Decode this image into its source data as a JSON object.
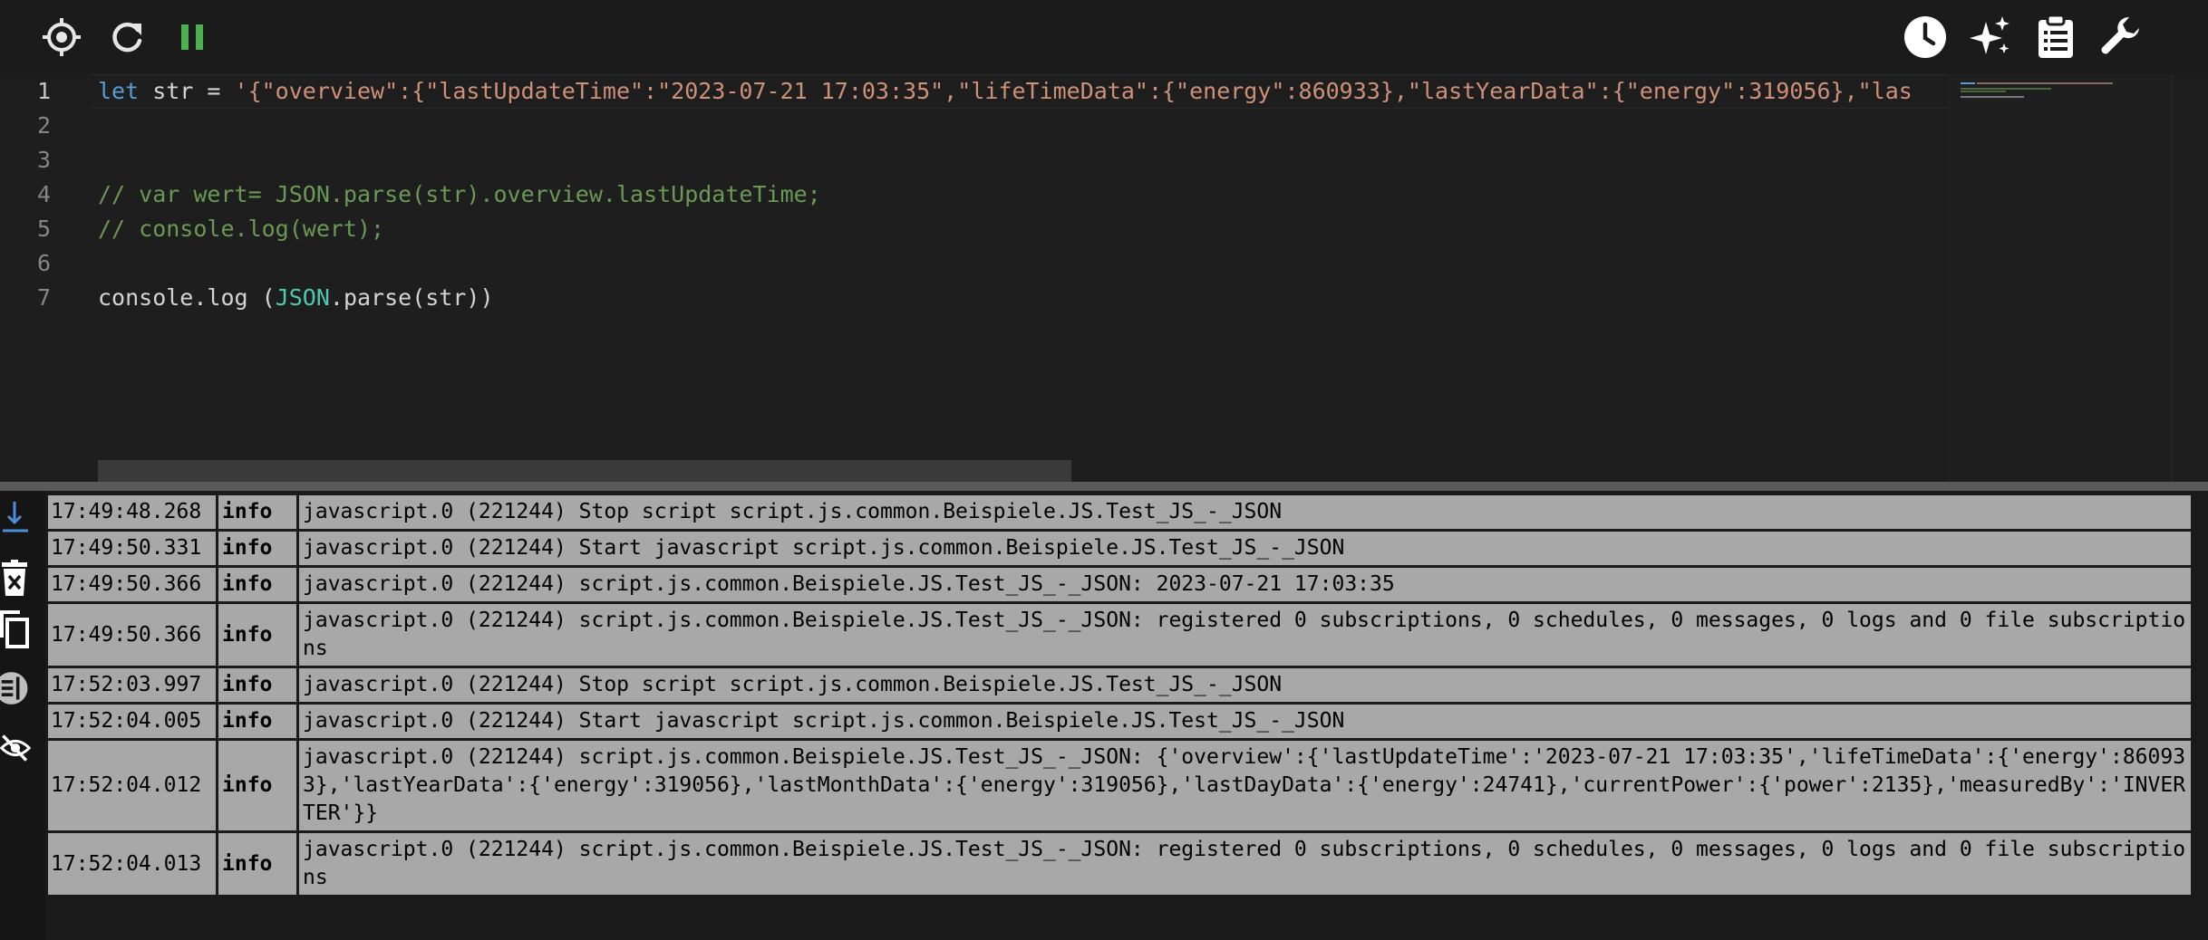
{
  "toolbar": {
    "left_icons": [
      "target-icon",
      "refresh-icon",
      "pause-icon"
    ],
    "right_icons": [
      "clock-icon",
      "sparkles-icon",
      "clipboard-list-icon",
      "wrench-icon"
    ],
    "pause_color": "#4caf50"
  },
  "editor": {
    "active_line": 1,
    "line_numbers": [
      "1",
      "2",
      "3",
      "4",
      "5",
      "6",
      "7"
    ],
    "lines": {
      "l1_kw": "let",
      "l1_mid": " str = ",
      "l1_str": "'{\"overview\":{\"lastUpdateTime\":\"2023-07-21 17:03:35\",\"lifeTimeData\":{\"energy\":860933},\"lastYearData\":{\"energy\":319056},\"las",
      "l4": "// var wert= JSON.parse(str).overview.lastUpdateTime;",
      "l5": "// console.log(wert);",
      "l7_a": "console.log (",
      "l7_type": "JSON",
      "l7_b": ".parse(str))"
    },
    "colors": {
      "keyword": "#569cd6",
      "string": "#ce9178",
      "comment": "#6a9955",
      "type": "#4ec9b0"
    }
  },
  "log_tools": [
    "scroll-to-bottom-icon",
    "delete-log-icon",
    "copy-icon",
    "columns-icon",
    "hide-icon"
  ],
  "log": {
    "rows": [
      {
        "time": "17:49:48.268",
        "severity": "info",
        "message": "javascript.0 (221244) Stop script script.js.common.Beispiele.JS.Test_JS_-_JSON"
      },
      {
        "time": "17:49:50.331",
        "severity": "info",
        "message": "javascript.0 (221244) Start javascript script.js.common.Beispiele.JS.Test_JS_-_JSON"
      },
      {
        "time": "17:49:50.366",
        "severity": "info",
        "message": "javascript.0 (221244) script.js.common.Beispiele.JS.Test_JS_-_JSON: 2023-07-21 17:03:35"
      },
      {
        "time": "17:49:50.366",
        "severity": "info",
        "message": "javascript.0 (221244) script.js.common.Beispiele.JS.Test_JS_-_JSON: registered 0 subscriptions, 0 schedules, 0 messages, 0 logs and 0 file subscriptions"
      },
      {
        "time": "17:52:03.997",
        "severity": "info",
        "message": "javascript.0 (221244) Stop script script.js.common.Beispiele.JS.Test_JS_-_JSON"
      },
      {
        "time": "17:52:04.005",
        "severity": "info",
        "message": "javascript.0 (221244) Start javascript script.js.common.Beispiele.JS.Test_JS_-_JSON"
      },
      {
        "time": "17:52:04.012",
        "severity": "info",
        "message": "javascript.0 (221244) script.js.common.Beispiele.JS.Test_JS_-_JSON: {'overview':{'lastUpdateTime':'2023-07-21 17:03:35','lifeTimeData':{'energy':860933},'lastYearData':{'energy':319056},'lastMonthData':{'energy':319056},'lastDayData':{'energy':24741},'currentPower':{'power':2135},'measuredBy':'INVERTER'}}"
      },
      {
        "time": "17:52:04.013",
        "severity": "info",
        "message": "javascript.0 (221244) script.js.common.Beispiele.JS.Test_JS_-_JSON: registered 0 subscriptions, 0 schedules, 0 messages, 0 logs and 0 file subscriptions"
      }
    ]
  }
}
